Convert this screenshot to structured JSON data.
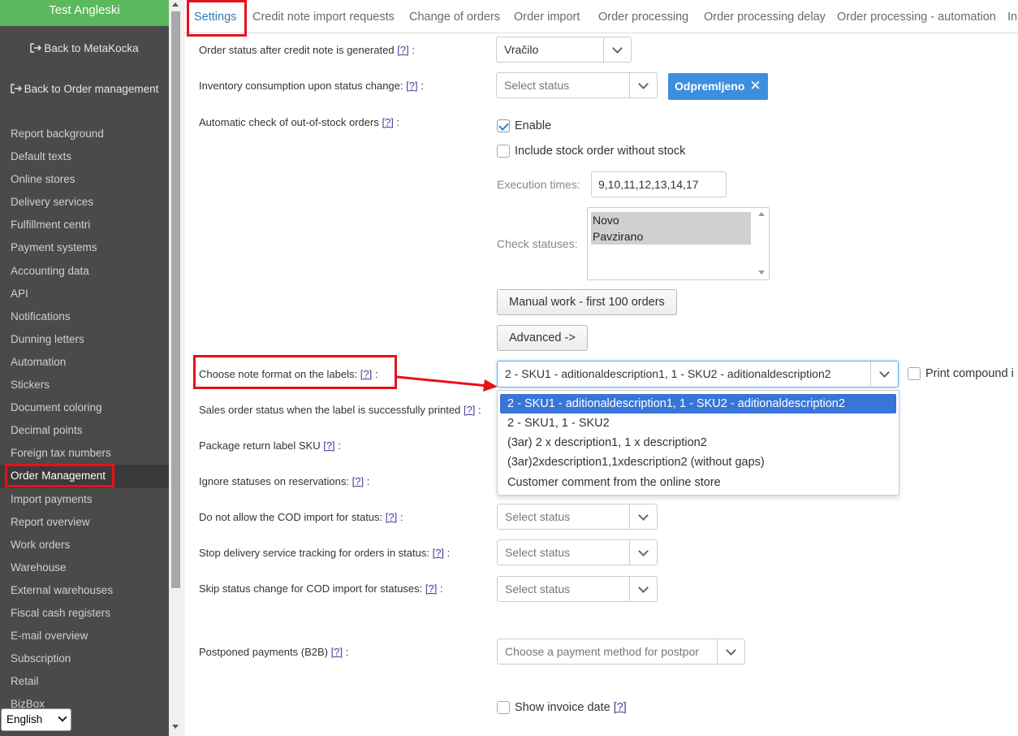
{
  "sidebar": {
    "brand": "Test Angleski",
    "back_metakocka": "Back to MetaKocka",
    "back_order_mgmt": "Back to Order management",
    "items": [
      "Report background",
      "Default texts",
      "Online stores",
      "Delivery services",
      "Fulfillment centri",
      "Payment systems",
      "Accounting data",
      "API",
      "Notifications",
      "Dunning letters",
      "Automation",
      "Stickers",
      "Document coloring",
      "Decimal points",
      "Foreign tax numbers",
      "Order Management",
      "Import payments",
      "Report overview",
      "Work orders",
      "Warehouse",
      "External warehouses",
      "Fiscal cash registers",
      "E-mail overview",
      "Subscription",
      "Retail",
      "BizBox"
    ],
    "active_item": "Order Management",
    "language": "English"
  },
  "tabs": [
    "Settings",
    "Credit note import requests",
    "Change of orders",
    "Order import",
    "Order processing",
    "Order processing delay",
    "Order processing - automation",
    "In"
  ],
  "active_tab": "Settings",
  "help_marker": "[?]",
  "form": {
    "credit_note_status": {
      "label": "Order status after credit note is generated",
      "value": "Vračilo"
    },
    "inventory_consumption": {
      "label": "Inventory consumption upon status change:",
      "placeholder": "Select status",
      "tag": "Odpremljeno"
    },
    "auto_check": {
      "label": "Automatic check of out-of-stock orders",
      "enable_label": "Enable",
      "include_label": "Include stock order without stock",
      "exec_times_label": "Execution times:",
      "exec_times_value": "9,10,11,12,13,14,17",
      "check_statuses_label": "Check statuses:",
      "check_statuses": [
        "Novo",
        "Pavzirano"
      ],
      "manual_work_button": "Manual work - first 100 orders",
      "advanced_button": "Advanced ->"
    },
    "note_format": {
      "label": "Choose note format on the labels:",
      "value": "2 - SKU1 - aditionaldescription1, 1 - SKU2 - aditionaldescription2",
      "print_compound": "Print compound i",
      "options": [
        "2 - SKU1 - aditionaldescription1, 1 - SKU2 - aditionaldescription2",
        "2 - SKU1, 1 - SKU2",
        "(3ar) 2 x description1, 1 x description2",
        "(3ar)2xdescription1,1xdescription2 (without gaps)",
        "Customer comment from the online store"
      ]
    },
    "label_printed_status": {
      "label": "Sales order status when the label is successfully printed"
    },
    "package_return_sku": {
      "label": "Package return label SKU"
    },
    "ignore_statuses": {
      "label": "Ignore statuses on reservations:"
    },
    "no_cod_import": {
      "label": "Do not allow the COD import for status:",
      "placeholder": "Select status"
    },
    "stop_tracking": {
      "label": "Stop delivery service tracking for orders in status:",
      "placeholder": "Select status"
    },
    "skip_status_change": {
      "label": "Skip status change for COD import for statuses:",
      "placeholder": "Select status"
    },
    "postponed_payments": {
      "label": "Postponed payments (B2B)",
      "placeholder": "Choose a payment method for postpor"
    },
    "show_invoice_date": {
      "label": "Show invoice date"
    }
  }
}
